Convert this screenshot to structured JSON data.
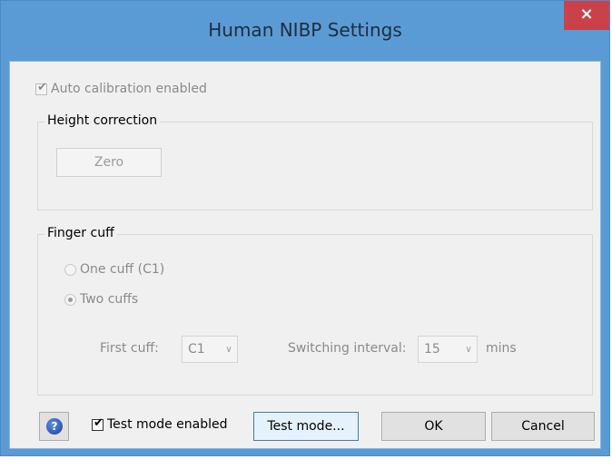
{
  "window": {
    "title": "Human NIBP Settings",
    "close_glyph": "×"
  },
  "auto_calibration": {
    "label": "Auto calibration enabled",
    "checked": true,
    "enabled": false
  },
  "height_correction": {
    "label": "Height correction",
    "zero_button": "Zero"
  },
  "finger_cuff": {
    "label": "Finger cuff",
    "one_cuff": "One cuff (C1)",
    "two_cuffs": "Two cuffs",
    "selected": "two_cuffs",
    "first_cuff_label": "First cuff:",
    "first_cuff_value": "C1",
    "switching_label": "Switching interval:",
    "switching_value": "15",
    "switching_unit": "mins"
  },
  "footer": {
    "help_icon": "help-icon",
    "test_mode_label": "Test mode enabled",
    "test_mode_checked": true,
    "test_mode_button": "Test mode...",
    "ok_button": "OK",
    "cancel_button": "Cancel"
  },
  "colors": {
    "titlebar": "#5b9bd5",
    "close": "#c9424a",
    "client": "#f0f0f0"
  }
}
